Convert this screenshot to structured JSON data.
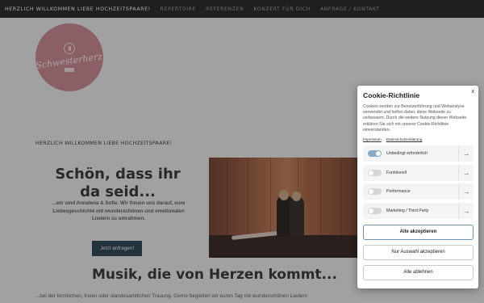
{
  "nav": {
    "items": [
      "HERZLICH WILLKOMMEN LIEBE HOCHZEITSPAARE!",
      "REPERTOIRE",
      "REFERENZEN",
      "KONZERT FÜR DICH",
      "ANFRAGE / KONTAKT"
    ]
  },
  "logo": {
    "brand": "Schwesterherz",
    "icon": "microphone-icon"
  },
  "hero": {
    "kicker": "HERZLICH WILLKOMMEN LIEBE HOCHZEITSPAARE!",
    "title": "Schön, dass ihr da seid...",
    "text": "...wir sind Annalena & Sofie. Wir freuen uns darauf, eure Liebesgeschichte mit wunderschönen und emotionalen Liedern zu umrahmen.",
    "cta": "Jetzt anfragen!"
  },
  "section": {
    "title": "Musik, die von Herzen kommt...",
    "text": "...bei der kirchlichen, freien oder standesamtlichen Trauung. Gerne begleiten wir euren Tag mit wunderschönen Liedern"
  },
  "cookie": {
    "title": "Cookie-Richtlinie",
    "close": "x",
    "description": "Cookies werden zur Benutzerführung und Webanalyse verwendet und helfen dabei, diese Webseite zu verbessern. Durch die weitere Nutzung dieser Webseite erklären Sie sich mit unserer Cookie-Richtlinie einverstanden.",
    "links": [
      "Impressum",
      "Datenschutzerklärung"
    ],
    "categories": [
      {
        "label": "Unbedingt erforderlich",
        "enabled": true
      },
      {
        "label": "Funktionell",
        "enabled": false
      },
      {
        "label": "Performance",
        "enabled": false
      },
      {
        "label": "Marketing / Third Party",
        "enabled": false
      }
    ],
    "accept_all": "Alle akzeptieren",
    "accept_selection": "Nur Auswahl akzeptieren",
    "reject_all": "Alle ablehnen",
    "accent": "#6c93b3"
  }
}
